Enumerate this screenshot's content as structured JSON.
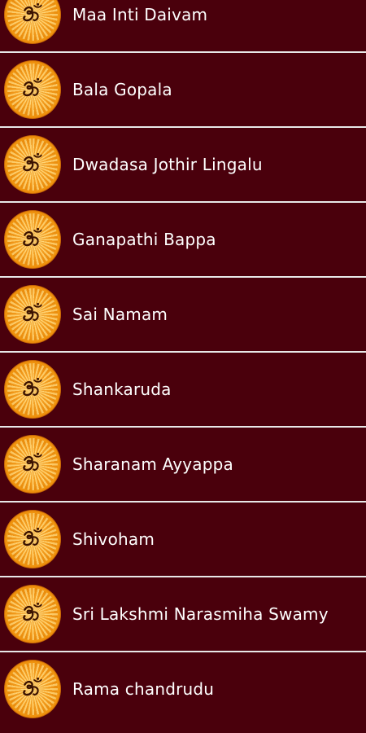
{
  "songs": [
    {
      "title": "Maa Inti Daivam",
      "icon": "om-icon"
    },
    {
      "title": "Bala Gopala",
      "icon": "om-icon"
    },
    {
      "title": "Dwadasa Jothir Lingalu",
      "icon": "om-icon"
    },
    {
      "title": "Ganapathi Bappa",
      "icon": "om-icon"
    },
    {
      "title": "Sai Namam",
      "icon": "om-icon"
    },
    {
      "title": "Shankaruda",
      "icon": "om-icon"
    },
    {
      "title": "Sharanam Ayyappa",
      "icon": "om-icon"
    },
    {
      "title": "Shivoham",
      "icon": "om-icon"
    },
    {
      "title": "Sri Lakshmi Narasmiha Swamy",
      "icon": "om-icon"
    },
    {
      "title": "Rama chandrudu",
      "icon": "om-icon"
    }
  ],
  "colors": {
    "background": "#4a000c",
    "divider": "#e8e8e8",
    "text": "#ffffff",
    "badge": "#f39a10"
  }
}
